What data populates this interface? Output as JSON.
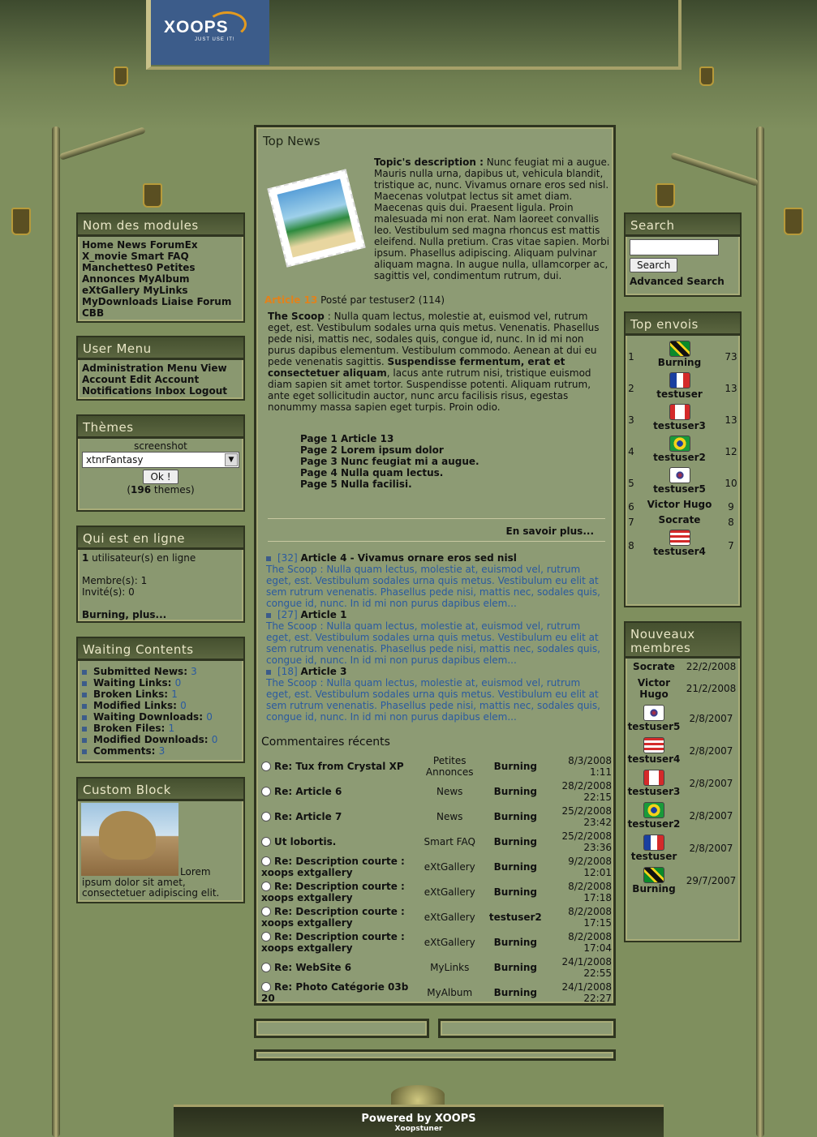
{
  "logo": {
    "text": "XOOPS",
    "tagline": "JUST USE IT!"
  },
  "modules": {
    "title": "Nom des modules",
    "items": [
      "Home",
      "News",
      "ForumEx",
      "X_movie",
      "Smart FAQ",
      "Manchettes0",
      "Petites Annonces",
      "MyAlbum",
      "eXtGallery",
      "MyLinks",
      "MyDownloads",
      "Liaise",
      "Forum",
      "CBB"
    ]
  },
  "usermenu": {
    "title": "User Menu",
    "items": [
      "Administration Menu",
      "View Account",
      "Edit Account",
      "Notifications",
      "Inbox",
      "Logout"
    ]
  },
  "themes": {
    "title": "Thèmes",
    "screenshot": "screenshot",
    "selected": "xtnrFantasy",
    "ok": "Ok !",
    "count": "196",
    "count_suffix": " themes)"
  },
  "online": {
    "title": "Qui est en ligne",
    "line1_count": "1",
    "line1_text": " utilisateur(s) en ligne",
    "members": "Membre(s): 1",
    "guests": "Invité(s): 0",
    "users": "Burning, plus..."
  },
  "waiting": {
    "title": "Waiting Contents",
    "items": [
      {
        "label": "Submitted News",
        "n": "3"
      },
      {
        "label": "Waiting Links",
        "n": "0"
      },
      {
        "label": "Broken Links",
        "n": "1"
      },
      {
        "label": "Modified Links",
        "n": "0"
      },
      {
        "label": "Waiting Downloads",
        "n": "0"
      },
      {
        "label": "Broken Files",
        "n": "1"
      },
      {
        "label": "Modified Downloads",
        "n": "0"
      },
      {
        "label": "Comments",
        "n": "3"
      }
    ]
  },
  "custom": {
    "title": "Custom Block",
    "text": "Lorem ipsum dolor sit amet, consectetuer adipiscing elit."
  },
  "topnews": {
    "title": "Top News",
    "topic_label": "Topic's description :",
    "topic_text": "Nunc feugiat mi a augue. Mauris nulla urna, dapibus ut, vehicula blandit, tristique ac, nunc. Vivamus ornare eros sed nisl. Maecenas volutpat lectus sit amet diam. Maecenas quis dui. Praesent ligula. Proin malesuada mi non erat. Nam laoreet convallis leo. Vestibulum sed magna rhoncus est mattis eleifend. Nulla pretium. Cras vitae sapien. Morbi ipsum. Phasellus adipiscing. Aliquam pulvinar aliquam magna. In augue nulla, ullamcorper ac, sagittis vel, condimentum rutrum, dui.",
    "article": "Article 13",
    "posted": " Posté par testuser2 (114)",
    "scoop_label": "The Scoop",
    "scoop_a": " : Nulla quam lectus, molestie at, euismod vel, rutrum eget, est. Vestibulum sodales urna quis metus. Venenatis. Phasellus pede nisi, mattis nec, sodales quis, congue id, nunc. In id mi non purus dapibus elementum. Vestibulum commodo. Aenean at dui eu pede venenatis sagittis. ",
    "scoop_bold": "Suspendisse fermentum, erat et consectetuer aliquam",
    "scoop_b": ", lacus ante rutrum nisi, tristique euismod diam sapien sit amet tortor. Suspendisse potenti. Aliquam rutrum, ante eget sollicitudin auctor, nunc arcu facilisis risus, egestas nonummy massa sapien eget turpis. Proin odio.",
    "pages": [
      "Page 1 Article 13",
      "Page 2 Lorem ipsum dolor",
      "Page 3 Nunc feugiat mi a augue.",
      "Page 4 Nulla quam lectus.",
      "Page 5 Nulla facilisi."
    ],
    "more": "En savoir plus...",
    "items": [
      {
        "id": "[32]",
        "title": "Article 4 - Vivamus ornare eros sed nisl",
        "body": "The Scoop : Nulla quam lectus, molestie at, euismod vel, rutrum eget, est. Vestibulum sodales urna quis metus. Vestibulum eu elit at sem rutrum venenatis. Phasellus pede nisi, mattis nec, sodales quis, congue id, nunc. In id mi non purus dapibus elem..."
      },
      {
        "id": "[27]",
        "title": "Article 1",
        "body": "The Scoop : Nulla quam lectus, molestie at, euismod vel, rutrum eget, est. Vestibulum sodales urna quis metus. Vestibulum eu elit at sem rutrum venenatis. Phasellus pede nisi, mattis nec, sodales quis, congue id, nunc. In id mi non purus dapibus elem..."
      },
      {
        "id": "[18]",
        "title": "Article 3",
        "body": "The Scoop : Nulla quam lectus, molestie at, euismod vel, rutrum eget, est. Vestibulum sodales urna quis metus. Vestibulum eu elit at sem rutrum venenatis. Phasellus pede nisi, mattis nec, sodales quis, congue id, nunc. In id mi non purus dapibus elem..."
      }
    ]
  },
  "comments": {
    "title": "Commentaires récents",
    "rows": [
      {
        "t": "Re: Tux from Crystal XP",
        "m": "Petites Annonces",
        "u": "Burning",
        "d": "8/3/2008 1:11"
      },
      {
        "t": "Re: Article 6",
        "m": "News",
        "u": "Burning",
        "d": "28/2/2008 22:15"
      },
      {
        "t": "Re: Article 7",
        "m": "News",
        "u": "Burning",
        "d": "25/2/2008 23:42"
      },
      {
        "t": "Ut lobortis.",
        "m": "Smart FAQ",
        "u": "Burning",
        "d": "25/2/2008 23:36"
      },
      {
        "t": "Re: Description courte : xoops extgallery",
        "m": "eXtGallery",
        "u": "Burning",
        "d": "9/2/2008 12:01"
      },
      {
        "t": "Re: Description courte : xoops extgallery",
        "m": "eXtGallery",
        "u": "Burning",
        "d": "8/2/2008 17:18"
      },
      {
        "t": "Re: Description courte : xoops extgallery",
        "m": "eXtGallery",
        "u": "testuser2",
        "d": "8/2/2008 17:15"
      },
      {
        "t": "Re: Description courte : xoops extgallery",
        "m": "eXtGallery",
        "u": "Burning",
        "d": "8/2/2008 17:04"
      },
      {
        "t": "Re: WebSite 6",
        "m": "MyLinks",
        "u": "Burning",
        "d": "24/1/2008 22:55"
      },
      {
        "t": "Re: Photo Catégorie 03b 20",
        "m": "MyAlbum",
        "u": "Burning",
        "d": "24/1/2008 22:27"
      }
    ]
  },
  "search": {
    "title": "Search",
    "button": "Search",
    "advanced": "Advanced Search"
  },
  "topposters": {
    "title": "Top envois",
    "rows": [
      {
        "r": "1",
        "name": "Burning",
        "n": "73",
        "flag": "jamaica"
      },
      {
        "r": "2",
        "name": "testuser",
        "n": "13",
        "flag": "france"
      },
      {
        "r": "3",
        "name": "testuser3",
        "n": "13",
        "flag": "canada"
      },
      {
        "r": "4",
        "name": "testuser2",
        "n": "12",
        "flag": "brazil"
      },
      {
        "r": "5",
        "name": "testuser5",
        "n": "10",
        "flag": "korea"
      },
      {
        "r": "6",
        "name": "Victor Hugo",
        "n": "9",
        "flag": ""
      },
      {
        "r": "7",
        "name": "Socrate",
        "n": "8",
        "flag": ""
      },
      {
        "r": "8",
        "name": "testuser4",
        "n": "7",
        "flag": "usa"
      }
    ]
  },
  "newmembers": {
    "title": "Nouveaux membres",
    "rows": [
      {
        "name": "Socrate",
        "d": "22/2/2008",
        "flag": ""
      },
      {
        "name": "Victor Hugo",
        "d": "21/2/2008",
        "flag": ""
      },
      {
        "name": "testuser5",
        "d": "2/8/2007",
        "flag": "korea"
      },
      {
        "name": "testuser4",
        "d": "2/8/2007",
        "flag": "usa"
      },
      {
        "name": "testuser3",
        "d": "2/8/2007",
        "flag": "canada"
      },
      {
        "name": "testuser2",
        "d": "2/8/2007",
        "flag": "brazil"
      },
      {
        "name": "testuser",
        "d": "2/8/2007",
        "flag": "france"
      },
      {
        "name": "Burning",
        "d": "29/7/2007",
        "flag": "jamaica"
      }
    ]
  },
  "footer": {
    "powered": "Powered by XOOPS",
    "by": "Xoopstuner"
  }
}
